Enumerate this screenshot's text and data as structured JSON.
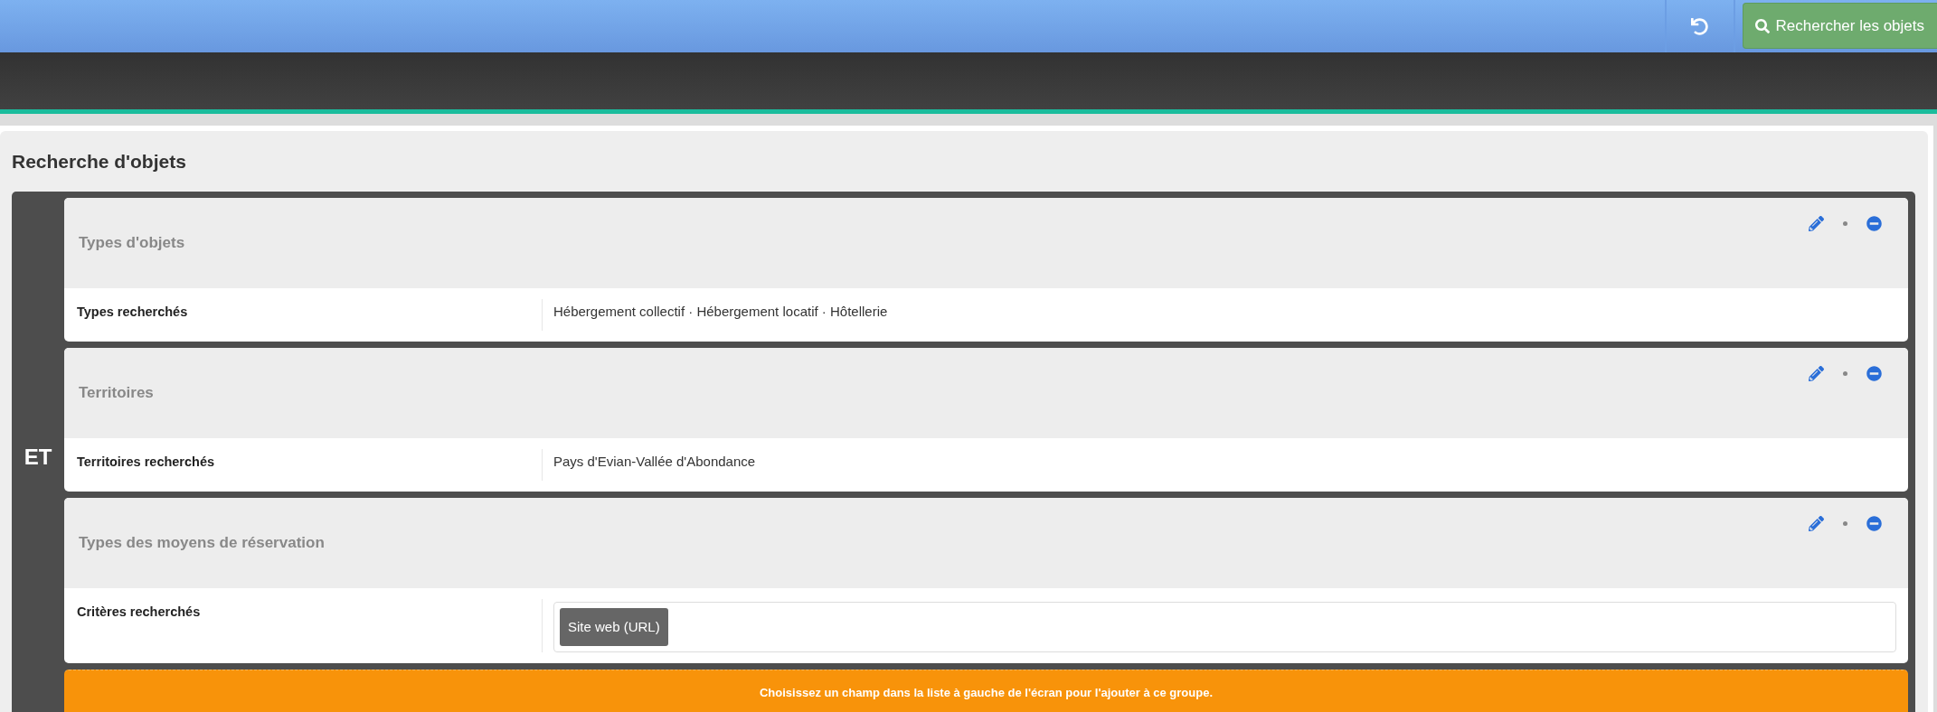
{
  "toolbar": {
    "search_button": "Rechercher les objets"
  },
  "panel": {
    "title": "Recherche d'objets",
    "group": {
      "operator": "ET",
      "criteria": [
        {
          "title": "Types d'objets",
          "label": "Types recherchés",
          "kind": "text",
          "value": "Hébergement collectif · Hébergement locatif · Hôtellerie"
        },
        {
          "title": "Territoires",
          "label": "Territoires recherchés",
          "kind": "text",
          "value": "Pays d'Evian-Vallée d'Abondance"
        },
        {
          "title": "Types des moyens de réservation",
          "label": "Critères recherchés",
          "kind": "tags",
          "tags": [
            "Site web (URL)"
          ]
        }
      ],
      "hint": "Choisissez un champ dans la liste à gauche de l'écran pour l'ajouter à ce groupe."
    }
  }
}
